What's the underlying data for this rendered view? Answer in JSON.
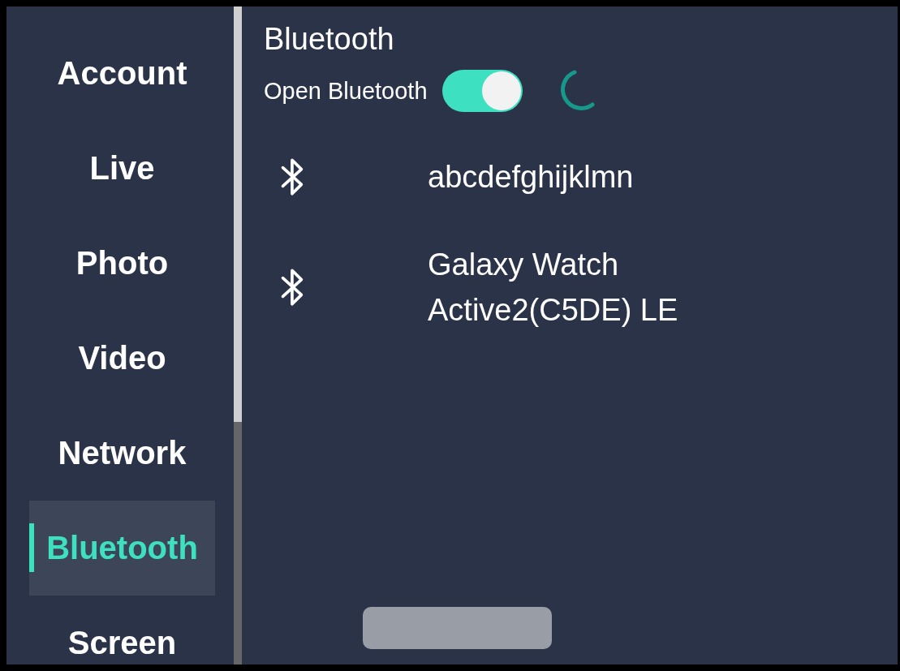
{
  "sidebar": {
    "items": [
      {
        "label": "Account",
        "selected": false
      },
      {
        "label": "Live",
        "selected": false
      },
      {
        "label": "Photo",
        "selected": false
      },
      {
        "label": "Video",
        "selected": false
      },
      {
        "label": "Network",
        "selected": false
      },
      {
        "label": "Bluetooth",
        "selected": true
      },
      {
        "label": "Screen",
        "selected": false
      }
    ]
  },
  "content": {
    "title": "Bluetooth",
    "switch": {
      "label": "Open Bluetooth",
      "on": true
    },
    "scanning": true,
    "devices": [
      {
        "name": "abcdefghijklmn"
      },
      {
        "name": "Galaxy Watch Active2(C5DE) LE"
      }
    ]
  }
}
